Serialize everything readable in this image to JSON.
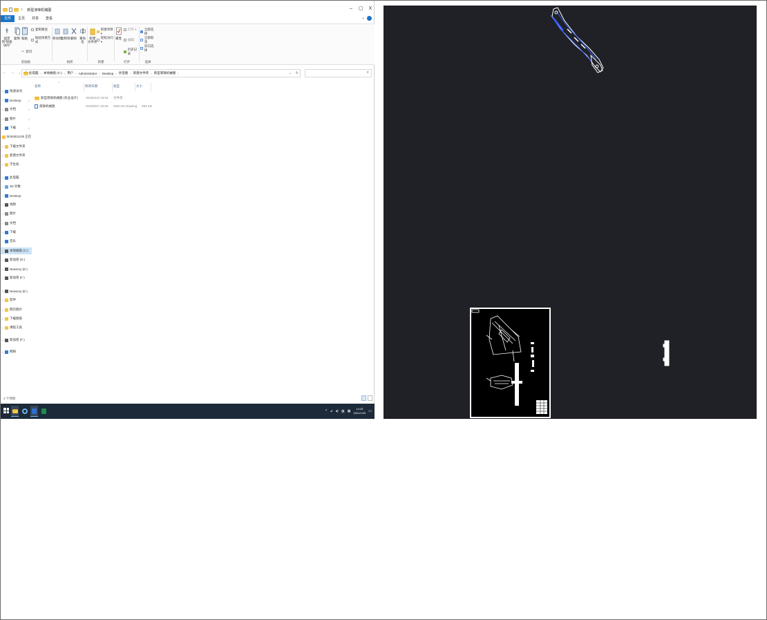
{
  "window": {
    "title": "新型液锋机械图",
    "controls": {
      "minimize": "–",
      "maximize": "▢",
      "close": "X"
    }
  },
  "menu": {
    "file": "文件",
    "tabs": [
      "主页",
      "共享",
      "查看"
    ]
  },
  "ribbon": {
    "clipboard": {
      "group": "剪贴板",
      "pin": "固定到\"快速访问\"",
      "copy": "复制",
      "paste": "粘贴",
      "cut": "剪切",
      "copy_path": "复制路径",
      "paste_shortcut": "粘贴快捷方式"
    },
    "organize": {
      "group": "组织",
      "move_to": "移动到",
      "copy_to": "复制到",
      "delete": "删除",
      "rename": "重命名"
    },
    "new": {
      "group": "新建",
      "new_folder": "新建\n文件夹",
      "new_item": "新建项目 ▾",
      "easy_access": "轻松访问 ▾"
    },
    "open": {
      "group": "打开",
      "properties": "属性",
      "open": "打开 ▾",
      "edit": "编辑",
      "history": "历史记录"
    },
    "select": {
      "group": "选择",
      "select_all": "全部选择",
      "select_none": "全部取消",
      "invert": "反向选择"
    }
  },
  "address": {
    "crumbs": [
      "此电脑",
      "本地磁盘 (C:)",
      "用户",
      "Administrator",
      "Desktop",
      "孙莲图",
      "新建文件夹",
      "新型液锋机械图"
    ]
  },
  "nav": {
    "items": [
      {
        "label": "快速访问",
        "icon": "star-icon",
        "type": "header"
      },
      {
        "label": "Desktop",
        "icon": "desktop-icon",
        "pinned": true
      },
      {
        "label": "文档",
        "icon": "document-icon",
        "pinned": true
      },
      {
        "label": "图片",
        "icon": "picture-icon",
        "pinned": true
      },
      {
        "label": "下载",
        "icon": "download-icon",
        "pinned": true
      },
      {
        "label": "tb262811105 正在…",
        "icon": "folder-icon"
      },
      {
        "label": "下载文件夹",
        "icon": "folder-icon"
      },
      {
        "label": "新建文件夹",
        "icon": "folder-icon"
      },
      {
        "label": "学生机",
        "icon": "folder-icon"
      },
      {
        "label": "此电脑",
        "icon": "computer-icon",
        "type": "header"
      },
      {
        "label": "3D 对象",
        "icon": "cube-icon"
      },
      {
        "label": "Desktop",
        "icon": "desktop-icon"
      },
      {
        "label": "视频",
        "icon": "video-icon"
      },
      {
        "label": "图片",
        "icon": "picture-icon"
      },
      {
        "label": "文档",
        "icon": "document-icon"
      },
      {
        "label": "下载",
        "icon": "download-icon"
      },
      {
        "label": "音乐",
        "icon": "music-icon"
      },
      {
        "label": "本地磁盘 (C:)",
        "icon": "drive-icon",
        "selected": true
      },
      {
        "label": "新加卷 (D:)",
        "icon": "drive-icon"
      },
      {
        "label": "Newsmy (E:)",
        "icon": "drive-icon"
      },
      {
        "label": "新加卷 (F:)",
        "icon": "drive-icon"
      },
      {
        "label": "Newsmy (E:)",
        "icon": "drive-icon",
        "type": "header"
      },
      {
        "label": "软件",
        "icon": "folder-icon"
      },
      {
        "label": "网页图片",
        "icon": "folder-icon"
      },
      {
        "label": "下载图纸",
        "icon": "folder-icon"
      },
      {
        "label": "课程工具",
        "icon": "folder-icon"
      },
      {
        "label": "新加卷 (F:)",
        "icon": "drive-icon",
        "type": "header"
      },
      {
        "label": "网络",
        "icon": "network-icon",
        "type": "header"
      }
    ]
  },
  "list": {
    "columns": [
      "名称",
      "修改日期",
      "类型",
      "大小"
    ],
    "rows": [
      {
        "name": "新型液锋机械图 (毕业设计)",
        "date": "2018/4/13 19:53",
        "type": "文件夹",
        "size": "",
        "icon": "folder-icon"
      },
      {
        "name": "液锋机械图",
        "date": "2016/5/27 20:05",
        "type": "ZWCAD Drawing",
        "size": "393 KB",
        "icon": "dwg-file-icon"
      }
    ]
  },
  "status": {
    "count": "2 个项目"
  },
  "taskbar": {
    "apps": [
      "start-icon",
      "file-explorer-icon",
      "browser-icon",
      "word-icon",
      "excel-icon"
    ],
    "tray": {
      "chevron": "^",
      "ime": "英",
      "time": "14:25",
      "date": "2021/1/29"
    }
  },
  "colors": {
    "accent": "#1a73c7",
    "cad_background": "#1f2126",
    "taskbar": "#1c2a3a",
    "selection": "#cce4f7"
  }
}
